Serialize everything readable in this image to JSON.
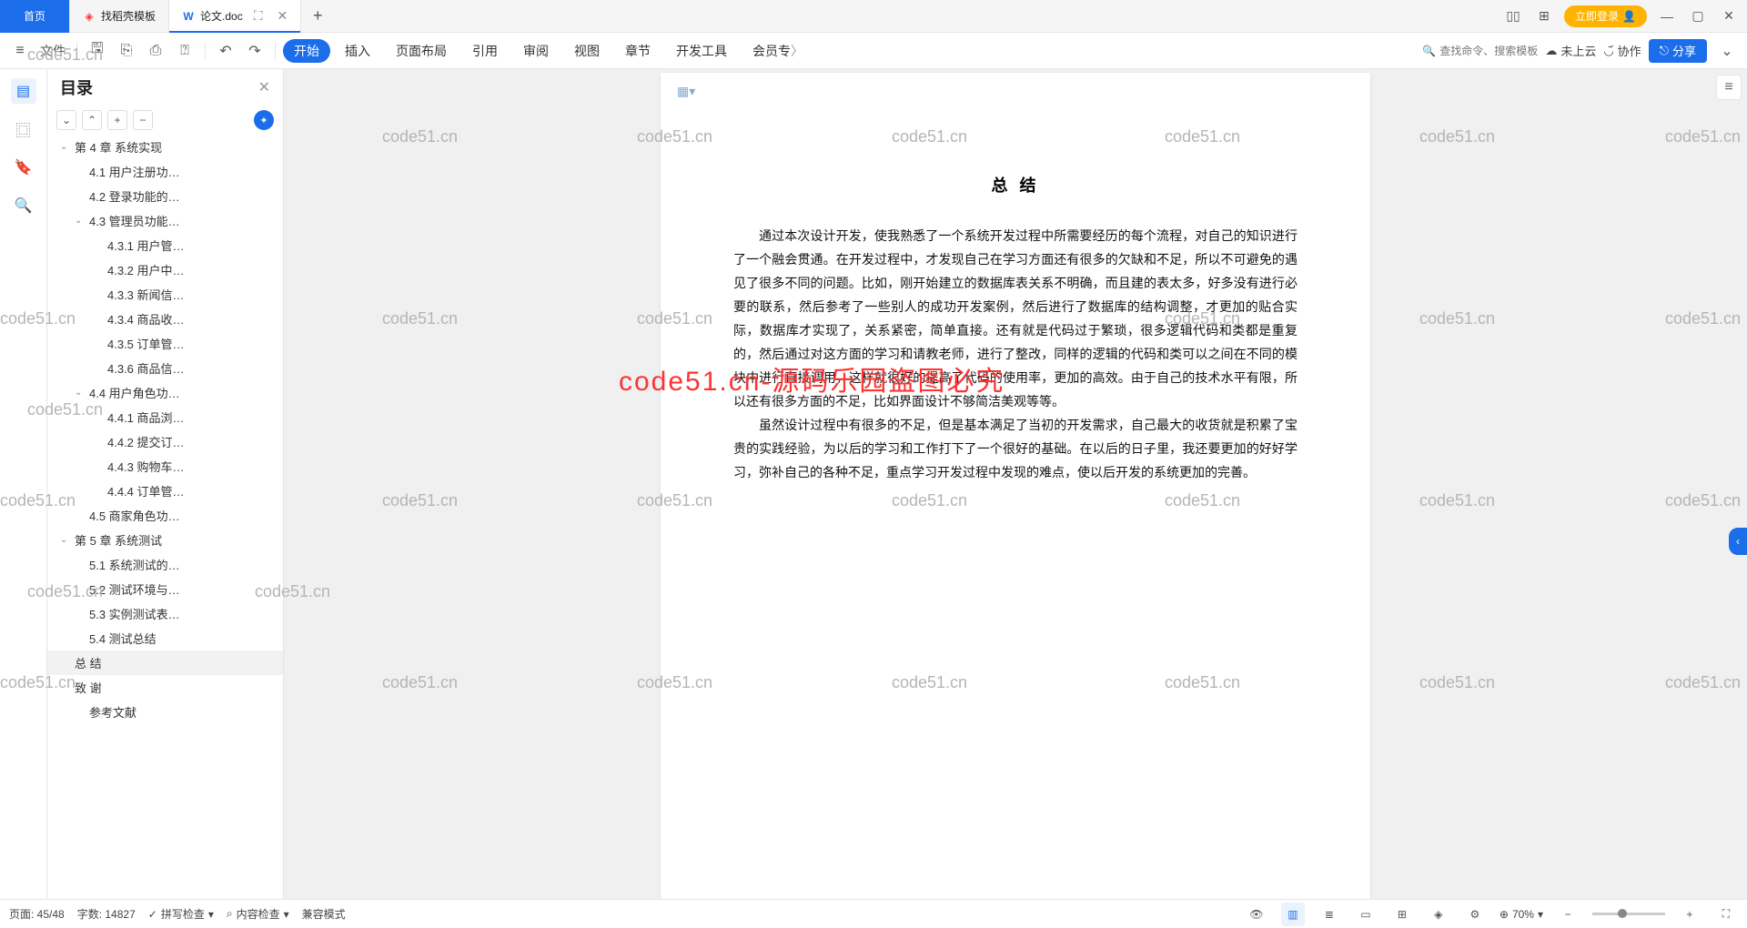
{
  "tabs": {
    "home": "首页",
    "t1": "找稻壳模板",
    "t2": "论文.doc"
  },
  "login": "立即登录",
  "ribbon": {
    "file": "文件",
    "tabs": [
      "开始",
      "插入",
      "页面布局",
      "引用",
      "审阅",
      "视图",
      "章节",
      "开发工具",
      "会员专"
    ],
    "search": "查找命令、搜索模板",
    "cloud": "未上云",
    "coop": "协作",
    "share": "分享"
  },
  "outline": {
    "title": "目录",
    "items": [
      {
        "t": "第 4 章 系统实现",
        "lv": 1,
        "c": 1
      },
      {
        "t": "4.1 用户注册功…",
        "lv": 2
      },
      {
        "t": "4.2 登录功能的…",
        "lv": 2
      },
      {
        "t": "4.3 管理员功能…",
        "lv": 2,
        "c": 1
      },
      {
        "t": "4.3.1 用户管…",
        "lv": 3
      },
      {
        "t": "4.3.2 用户中…",
        "lv": 3
      },
      {
        "t": "4.3.3 新闻信…",
        "lv": 3
      },
      {
        "t": "4.3.4 商品收…",
        "lv": 3
      },
      {
        "t": "4.3.5 订单管…",
        "lv": 3
      },
      {
        "t": "4.3.6 商品信…",
        "lv": 3
      },
      {
        "t": "4.4 用户角色功…",
        "lv": 2,
        "c": 1
      },
      {
        "t": "4.4.1 商品浏…",
        "lv": 3
      },
      {
        "t": "4.4.2 提交订…",
        "lv": 3
      },
      {
        "t": "4.4.3 购物车…",
        "lv": 3
      },
      {
        "t": "4.4.4 订单管…",
        "lv": 3
      },
      {
        "t": "4.5 商家角色功…",
        "lv": 2
      },
      {
        "t": "第 5 章  系统测试",
        "lv": 1,
        "c": 1
      },
      {
        "t": "5.1 系统测试的…",
        "lv": 2
      },
      {
        "t": "5.2 测试环境与…",
        "lv": 2
      },
      {
        "t": "5.3 实例测试表…",
        "lv": 2
      },
      {
        "t": "5.4 测试总结",
        "lv": 2
      },
      {
        "t": "总  结",
        "lv": 1,
        "sel": 1
      },
      {
        "t": "致  谢",
        "lv": 1
      },
      {
        "t": "参考文献",
        "lv": 2
      }
    ]
  },
  "doc": {
    "title": "总  结",
    "p1": "通过本次设计开发，使我熟悉了一个系统开发过程中所需要经历的每个流程，对自己的知识进行了一个融会贯通。在开发过程中，才发现自己在学习方面还有很多的欠缺和不足，所以不可避免的遇见了很多不同的问题。比如，刚开始建立的数据库表关系不明确，而且建的表太多，好多没有进行必要的联系，然后参考了一些别人的成功开发案例，然后进行了数据库的结构调整，才更加的贴合实际，数据库才实现了，关系紧密，简单直接。还有就是代码过于繁琐，很多逻辑代码和类都是重复的，然后通过对这方面的学习和请教老师，进行了整改，同样的逻辑的代码和类可以之间在不同的模块中进行直接调用，这样就很好的提高了代码的使用率，更加的高效。由于自己的技术水平有限，所以还有很多方面的不足，比如界面设计不够简洁美观等等。",
    "p2": "虽然设计过程中有很多的不足，但是基本满足了当初的开发需求，自己最大的收货就是积累了宝贵的实践经验，为以后的学习和工作打下了一个很好的基础。在以后的日子里，我还要更加的好好学习，弥补自己的各种不足，重点学习开发过程中发现的难点，使以后开发的系统更加的完善。"
  },
  "status": {
    "page": "页面: 45/48",
    "words": "字数: 14827",
    "spell": "拼写检查",
    "content": "内容检查",
    "compat": "兼容模式",
    "zoom": "70%"
  },
  "wm": "code51.cn",
  "wm_red": "code51.cn-源码乐园盗图必究"
}
